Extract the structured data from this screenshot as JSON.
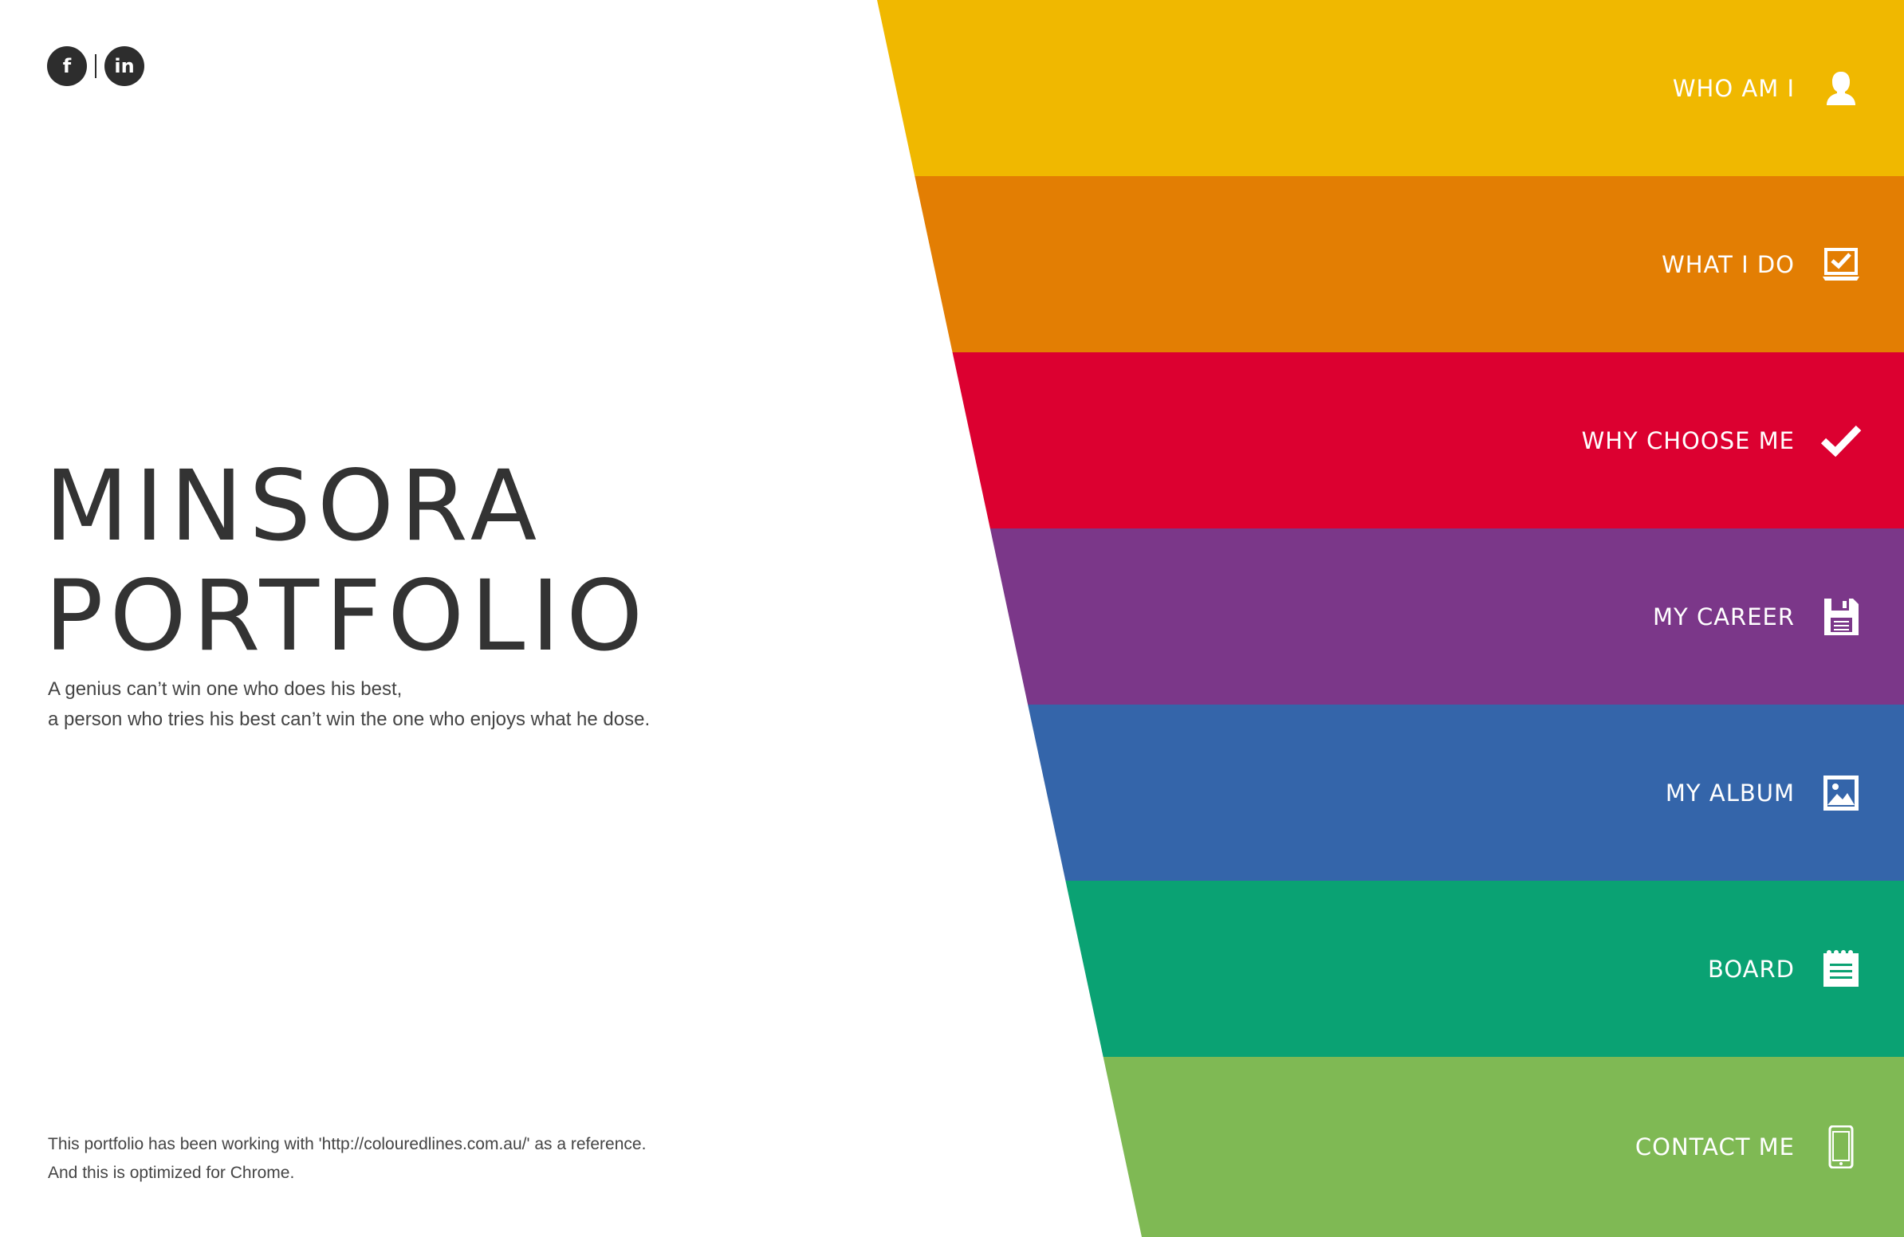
{
  "social": {
    "facebook_label": "f",
    "linkedin_label": "in"
  },
  "hero": {
    "title_line1": "MINSORA",
    "title_line2": "PORTFOLIO",
    "tagline_line1": "A genius can’t win one who does his best,",
    "tagline_line2": "a person who tries his best can’t win the one who enjoys what he dose."
  },
  "footer": {
    "line1": "This portfolio has been working with 'http://colouredlines.com.au/' as a reference.",
    "line2": "And this is optimized for Chrome."
  },
  "menu": [
    {
      "label": "WHO AM I",
      "icon": "person-icon",
      "color": "#F0B800"
    },
    {
      "label": "WHAT I DO",
      "icon": "laptop-check-icon",
      "color": "#E37E03"
    },
    {
      "label": "WHY CHOOSE ME",
      "icon": "checkmark-icon",
      "color": "#DC0030"
    },
    {
      "label": "MY CAREER",
      "icon": "floppy-disk-icon",
      "color": "#7B3789"
    },
    {
      "label": "MY ALBUM",
      "icon": "picture-icon",
      "color": "#3465AA"
    },
    {
      "label": "BOARD",
      "icon": "notepad-icon",
      "color": "#0AA273"
    },
    {
      "label": "CONTACT ME",
      "icon": "smartphone-icon",
      "color": "#7FB954"
    }
  ]
}
